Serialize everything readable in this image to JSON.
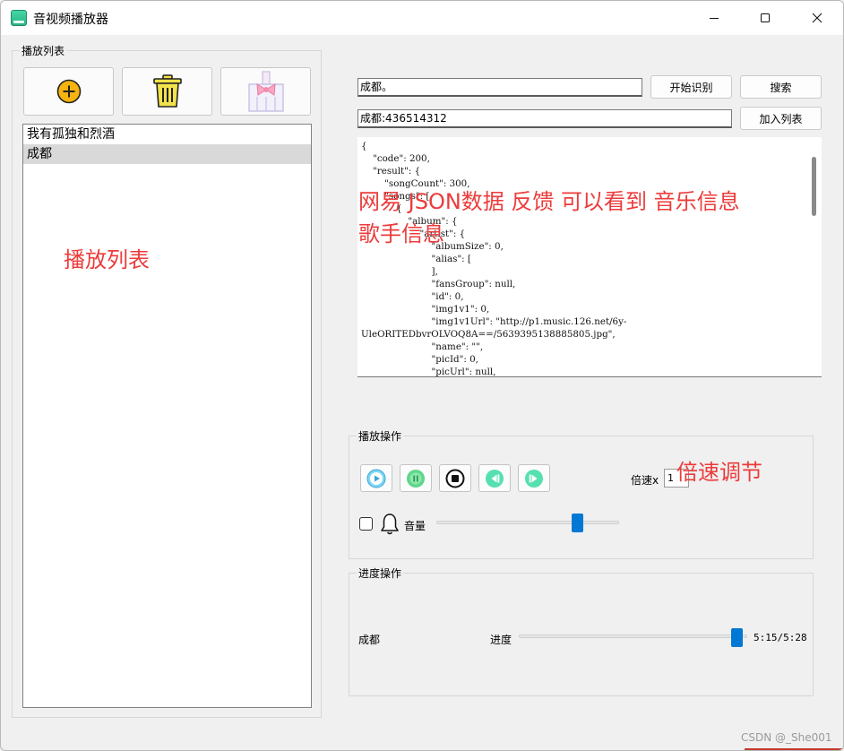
{
  "window": {
    "title": "音视频播放器",
    "controls": {
      "minimize": "—",
      "maximize": "☐",
      "close": "✕"
    }
  },
  "left_panel": {
    "group_label": "播放列表",
    "toolbar": [
      {
        "name": "add-button",
        "icon": "plus-circle-icon"
      },
      {
        "name": "delete-button",
        "icon": "trash-icon"
      },
      {
        "name": "clear-button",
        "icon": "broom-icon"
      }
    ],
    "playlist": [
      "我有孤独和烈酒",
      "成都"
    ],
    "selected_index": 1,
    "annotation": "播放列表"
  },
  "search": {
    "query_value": "成都。",
    "recognize_label": "开始识别",
    "search_label": "搜索",
    "result_value": "成都:436514312",
    "add_to_list_label": "加入列表"
  },
  "json_output": {
    "lines": [
      "{",
      "    \"code\": 200,",
      "    \"result\": {",
      "        \"songCount\": 300,",
      "        \"songs\": [",
      "            {",
      "                \"album\": {",
      "                    \"artist\": {",
      "                        \"albumSize\": 0,",
      "                        \"alias\": [",
      "                        ],",
      "                        \"fansGroup\": null,",
      "                        \"id\": 0,",
      "                        \"img1v1\": 0,",
      "                        \"img1v1Url\": \"http://p1.music.126.net/6y-",
      "UleORITEDbvrOLVOQ8A==/5639395138885805.jpg\",",
      "                        \"name\": \"\",",
      "                        \"picId\": 0,",
      "                        \"picUrl\": null,"
    ],
    "annotation_line1": "网易 JSON数据  反馈  可以看到 音乐信息",
    "annotation_line2": "歌手信息"
  },
  "playback": {
    "group_label": "播放操作",
    "buttons": [
      {
        "name": "play-button",
        "icon": "play-icon"
      },
      {
        "name": "pause-button",
        "icon": "pause-icon"
      },
      {
        "name": "stop-button",
        "icon": "stop-icon"
      },
      {
        "name": "previous-button",
        "icon": "skip-back-icon"
      },
      {
        "name": "next-button",
        "icon": "skip-forward-icon"
      }
    ],
    "speed_label": "倍速x",
    "speed_value": "1",
    "speed_annotation": "倍速调节",
    "volume_label": "音量",
    "volume_level": 0.79,
    "mute_checked": false
  },
  "progress": {
    "group_label": "进度操作",
    "track_name": "成都",
    "progress_label": "进度",
    "position": 0.98,
    "time_text": "5:15/5:28"
  },
  "watermark": "CSDN @_She001",
  "colors": {
    "annotation_red": "#ec3b3b",
    "slider_handle": "#0078d4"
  }
}
